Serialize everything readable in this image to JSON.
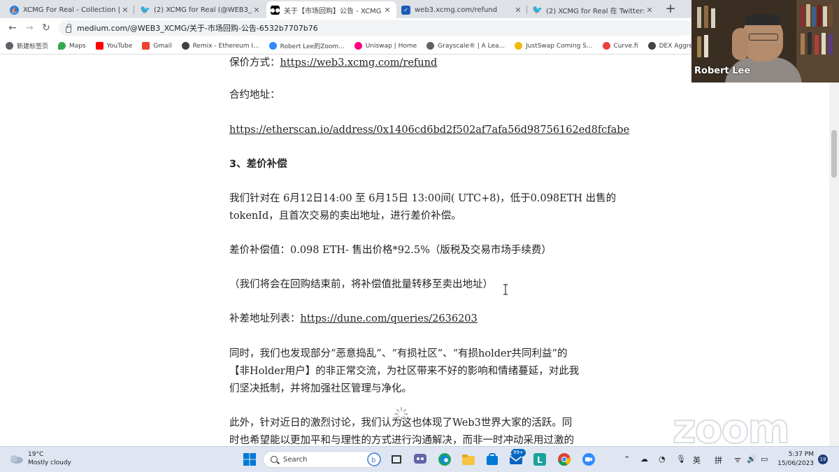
{
  "browser": {
    "tabs": [
      {
        "label": "XCMG For Real - Collection | Ope",
        "favicon": "opensea-icon",
        "color": "#2081e2",
        "active": false
      },
      {
        "label": "(2) XCMG for Real (@WEB3_XCM",
        "favicon": "twitter-icon",
        "color": "#1d9bf0",
        "active": false
      },
      {
        "label": "关于【市场回购】公告 - XCMG for",
        "favicon": "medium-icon",
        "color": "#000000",
        "active": true
      },
      {
        "label": "web3.xcmg.com/refund",
        "favicon": "checkbox-icon",
        "color": "#1a5bb8",
        "active": false
      },
      {
        "label": "(2) XCMG for Real 在 Twitter: \"关",
        "favicon": "twitter-icon",
        "color": "#1d9bf0",
        "active": false
      }
    ],
    "new_tab_label": "+",
    "url": "medium.com/@WEB3_XCMG/关于-市场回购-公告-6532b7707b76",
    "bookmarks": [
      {
        "label": "新建标签页",
        "color": "#5f6368"
      },
      {
        "label": "Maps",
        "color": "#34a853"
      },
      {
        "label": "YouTube",
        "color": "#ff0000"
      },
      {
        "label": "Gmail",
        "color": "#ea4335"
      },
      {
        "label": "Remix - Ethereum I...",
        "color": "#3c4043"
      },
      {
        "label": "Robert Lee的Zoom...",
        "color": "#2d8cff"
      },
      {
        "label": "Uniswap | Home",
        "color": "#ff007a"
      },
      {
        "label": "Grayscale® | A Lea...",
        "color": "#5f6368"
      },
      {
        "label": "JustSwap Coming S...",
        "color": "#f0b90b"
      },
      {
        "label": "Curve.fi",
        "color": "#e84142"
      },
      {
        "label": "DEX Aggrega",
        "color": "#444444"
      }
    ]
  },
  "article": {
    "refund_label": "保价方式：",
    "refund_link": "https://web3.xcmg.com/refund",
    "contract_label": "合约地址：",
    "contract_link": "https://etherscan.io/address/0x1406cd6bd2f502af7afa56d98756162ed8fcfabe",
    "section_heading": "3、差价补偿",
    "p1_line1": "我们针对在 6月12日14:00 至 6月15日 13:00间( UTC+8)，低于0.098ETH 出售的",
    "p1_line2": "tokenId，且首次交易的卖出地址，进行差价补偿。",
    "p2": "差价补偿值：0.098 ETH- 售出价格*92.5%（版税及交易市场手续费）",
    "p3": "（我们将会在回购结束前，将补偿值批量转移至卖出地址）",
    "list_label": "补差地址列表：",
    "list_link": "https://dune.com/queries/2636203",
    "p4_line1": "同时，我们也发现部分“恶意捣乱”、“有损社区”、“有损holder共同利益”的",
    "p4_line2": "【非Holder用户】的非正常交流，为社区带来不好的影响和情绪蔓延，对此我",
    "p4_line3": "们坚决抵制，并将加强社区管理与净化。",
    "p5_line1": "此外，针对近日的激烈讨论，我们认为这也体现了Web3世界大家的活跃。同",
    "p5_line2": "时也希望能以更加平和与理性的方式进行沟通解决，而非一时冲动采用过激的"
  },
  "zoom": {
    "participant_name": "Robert Lee",
    "watermark": "zoom"
  },
  "taskbar": {
    "temperature": "19°C",
    "weather": "Mostly cloudy",
    "search_placeholder": "Search",
    "badge": "99+",
    "ime_lang": "英",
    "ime_mode": "拼",
    "time": "5:37 PM",
    "date": "15/06/2023",
    "notifications": "19"
  }
}
